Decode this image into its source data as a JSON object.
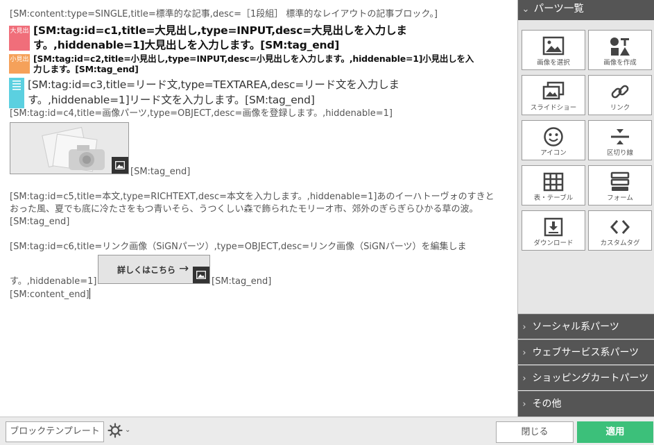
{
  "editor": {
    "content_start": "[SM:content:type=SINGLE,title=標準的な記事,desc=［1段組］ 標準的なレイアウトの記事ブロック。]",
    "h1_badge": "大見出",
    "h1_line1": "[SM:tag:id=c1,title=大見出し,type=INPUT,desc=大見出しを入力しま",
    "h1_line2": "す。,hiddenable=1]大見出しを入力します。[SM:tag_end]",
    "h2_badge": "小見出",
    "h2_line1": "[SM:tag:id=c2,title=小見出し,type=INPUT,desc=小見出しを入力します。,hiddenable=1]小見出しを入",
    "h2_line2": "力します。[SM:tag_end]",
    "lead_line1": "[SM:tag:id=c3,title=リード文,type=TEXTAREA,desc=リード文を入力しま",
    "lead_line2": "す。,hiddenable=1]リード文を入力します。[SM:tag_end]",
    "image_tag": "[SM:tag:id=c4,title=画像パーツ,type=OBJECT,desc=画像を登録します。,hiddenable=1]",
    "image_tag_end": "[SM:tag_end]",
    "body_line1": "[SM:tag:id=c5,title=本文,type=RICHTEXT,desc=本文を入力します。,hiddenable=1]あのイーハトーヴォのすきと",
    "body_line2": "おった風、夏でも底に冷たさをもつ青いそら、うつくしい森で飾られたモリーオ市、郊外のぎらぎらひかる草の波。",
    "body_line3": "[SM:tag_end]",
    "link_line1": "[SM:tag:id=c6,title=リンク画像（SiGNパーツ）,type=OBJECT,desc=リンク画像（SiGNパーツ）を編集しま",
    "link_line2": "す。,hiddenable=1]",
    "link_button": "詳しくはこちら",
    "link_tag_end": "[SM:tag_end]",
    "content_end": "[SM:content_end]"
  },
  "panel": {
    "title": "パーツ一覧",
    "parts": [
      {
        "label": "画像を選択",
        "icon": "image-icon"
      },
      {
        "label": "画像を作成",
        "icon": "create-image-icon"
      },
      {
        "label": "スライドショー",
        "icon": "slideshow-icon"
      },
      {
        "label": "リンク",
        "icon": "link-icon"
      },
      {
        "label": "アイコン",
        "icon": "smiley-icon"
      },
      {
        "label": "区切り線",
        "icon": "divider-icon"
      },
      {
        "label": "表・テーブル",
        "icon": "table-icon"
      },
      {
        "label": "フォーム",
        "icon": "form-icon"
      },
      {
        "label": "ダウンロード",
        "icon": "download-icon"
      },
      {
        "label": "カスタムタグ",
        "icon": "code-icon"
      }
    ],
    "categories": [
      "ソーシャル系パーツ",
      "ウェブサービス系パーツ",
      "ショッピングカートパーツ",
      "その他"
    ]
  },
  "footer": {
    "template_button": "ブロックテンプレート",
    "close_button": "閉じる",
    "apply_button": "適用"
  },
  "colors": {
    "h1_badge": "#f06e7a",
    "h2_badge": "#f5a15a",
    "lead_badge": "#5bd0e0",
    "apply": "#3cc07a",
    "panel_dark": "#555555"
  }
}
